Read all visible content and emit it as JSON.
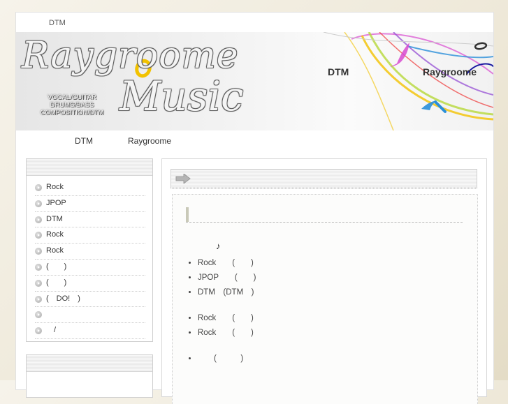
{
  "top_link": "DTM",
  "banner": {
    "logo_line1": "Raygroome",
    "logo_line2": "Music",
    "logo_sub": [
      "VOCAL/GUITAR",
      "DRUMS/BASS",
      "COMPOSITION/DTM"
    ],
    "nav": [
      "DTM",
      "Raygroome"
    ]
  },
  "main_nav": [
    "DTM",
    "Raygroome"
  ],
  "sidebar": {
    "items": [
      "Rock",
      "JPOP",
      "DTM",
      "Rock",
      "Rock",
      "(　　)",
      "(　　)",
      "(　DO!　)",
      "",
      "　/"
    ]
  },
  "content": {
    "note": "♪",
    "list1": [
      "Rock　　(　　)",
      "JPOP　　(　　)",
      "DTM　(DTM　)"
    ],
    "list2": [
      "Rock　　(　　)",
      "Rock　　(　　)"
    ],
    "list3": [
      "　　(　　　)"
    ]
  },
  "colors": {
    "accent_yellow": "#f2c200",
    "swirl_purple": "#c04ad6",
    "swirl_blue": "#2a8fd9"
  }
}
